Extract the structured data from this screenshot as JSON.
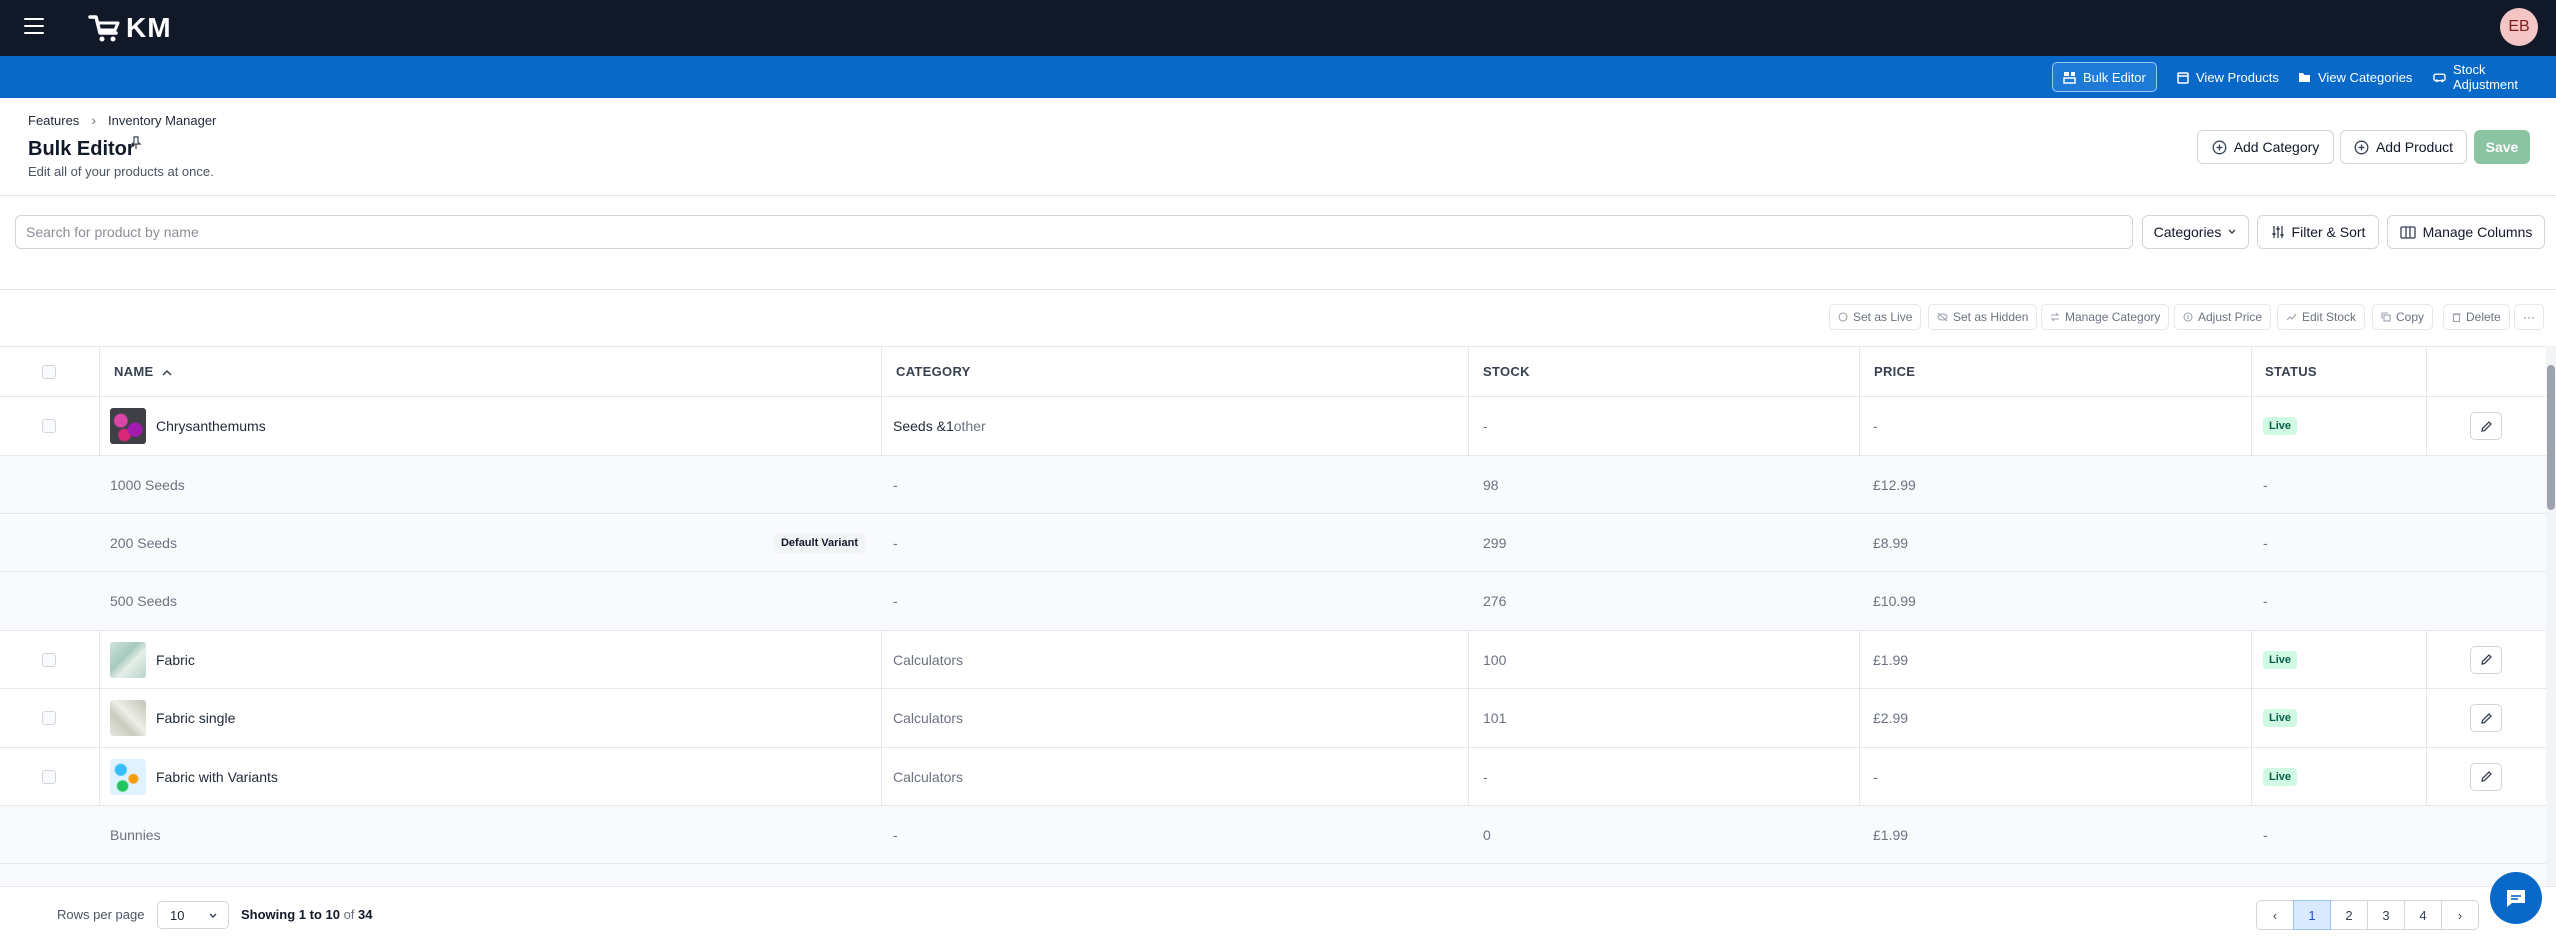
{
  "app": {
    "logo_text": "KM",
    "avatar_initials": "EB"
  },
  "nav": [
    {
      "label": "Bulk Editor",
      "icon": "bulk-editor-icon",
      "active": true
    },
    {
      "label": "View Products",
      "icon": "products-icon"
    },
    {
      "label": "View Categories",
      "icon": "folder-icon"
    },
    {
      "label": "Stock Adjustment",
      "icon": "stock-icon"
    }
  ],
  "breadcrumb": [
    "Features",
    "Inventory Manager"
  ],
  "page": {
    "title": "Bulk Editor",
    "subtitle": "Edit all of your products at once."
  },
  "header_buttons": {
    "add_category": "Add Category",
    "add_product": "Add Product",
    "save": "Save"
  },
  "search": {
    "placeholder": "Search for product by name"
  },
  "filters": {
    "categories": "Categories",
    "filter_sort": "Filter & Sort",
    "manage_columns": "Manage Columns"
  },
  "actions": [
    "Set as Live",
    "Set as Hidden",
    "Manage Category",
    "Adjust Price",
    "Edit Stock",
    "Copy",
    "Delete",
    "···"
  ],
  "table": {
    "columns": [
      "NAME",
      "CATEGORY",
      "STOCK",
      "PRICE",
      "STATUS"
    ],
    "rows": [
      {
        "type": "product",
        "name": "Chrysanthemums",
        "category": "Seeds & ",
        "category_extra": "1",
        "category_suffix": " other",
        "stock": "-",
        "price": "-",
        "status": "Live"
      },
      {
        "type": "variant",
        "name": "1000 Seeds",
        "category": "-",
        "stock": "98",
        "price": "£12.99",
        "status": "-"
      },
      {
        "type": "variant",
        "name": "200 Seeds",
        "badge": "Default Variant",
        "category": "-",
        "stock": "299",
        "price": "£8.99",
        "status": "-"
      },
      {
        "type": "variant",
        "name": "500 Seeds",
        "category": "-",
        "stock": "276",
        "price": "£10.99",
        "status": "-"
      },
      {
        "type": "product",
        "name": "Fabric",
        "category": "Calculators",
        "stock": "100",
        "price": "£1.99",
        "status": "Live"
      },
      {
        "type": "product",
        "name": "Fabric single",
        "category": "Calculators",
        "stock": "101",
        "price": "£2.99",
        "status": "Live"
      },
      {
        "type": "product",
        "name": "Fabric with Variants",
        "category": "Calculators",
        "stock": "-",
        "price": "-",
        "status": "Live"
      },
      {
        "type": "variant",
        "name": "Bunnies",
        "category": "-",
        "stock": "0",
        "price": "£1.99",
        "status": "-"
      }
    ]
  },
  "footer": {
    "rows_per_page_label": "Rows per page",
    "rows_per_page": "10",
    "showing_prefix": "Showing ",
    "showing_range": "1 to 10",
    "showing_of": " of ",
    "showing_total": "34",
    "pages": [
      "1",
      "2",
      "3",
      "4"
    ],
    "prev": "‹",
    "next": "›"
  },
  "colors": {
    "topbar": "#111827",
    "nav": "#0869c9",
    "save": "#8ac4a3",
    "live_badge": "#d1fae5"
  }
}
